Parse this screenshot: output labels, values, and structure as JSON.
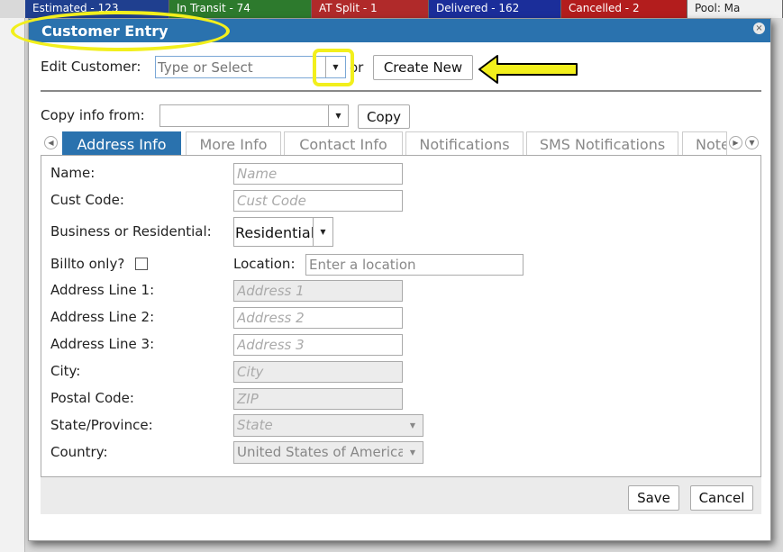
{
  "background": {
    "strip": [
      {
        "text": "Estimated - 123",
        "color": "#1f3f8f"
      },
      {
        "text": "In Transit - 74",
        "color": "#2d7a2d"
      },
      {
        "text": "AT Split - 1",
        "color": "#b02a2a"
      },
      {
        "text": "Delivered - 162",
        "color": "#1b2e9a"
      },
      {
        "text": "Cancelled - 2",
        "color": "#b31d1d"
      },
      {
        "text": "Pool: Ma",
        "color": "#f0f0f0"
      }
    ]
  },
  "dialog": {
    "title": "Customer Entry",
    "close_icon": "×",
    "edit_customer_label": "Edit Customer:",
    "edit_customer_placeholder": "Type or Select",
    "or_label": "or",
    "create_new_label": "Create New",
    "copy_info_label": "Copy info from:",
    "copy_info_value": "",
    "copy_label": "Copy",
    "tabs": [
      "Address Info",
      "More Info",
      "Contact Info",
      "Notifications",
      "SMS Notifications",
      "Notes"
    ],
    "active_tab": "Address Info",
    "form": {
      "name_label": "Name:",
      "name_placeholder": "Name",
      "cust_code_label": "Cust Code:",
      "cust_code_placeholder": "Cust Code",
      "business_label": "Business or Residential:",
      "business_value": "Residential",
      "billto_label": "Billto only?",
      "location_label": "Location:",
      "location_placeholder": "Enter a location",
      "address1_label": "Address Line 1:",
      "address1_placeholder": "Address 1",
      "address2_label": "Address Line 2:",
      "address2_placeholder": "Address 2",
      "address3_label": "Address Line 3:",
      "address3_placeholder": "Address 3",
      "city_label": "City:",
      "city_placeholder": "City",
      "postal_label": "Postal Code:",
      "postal_placeholder": "ZIP",
      "state_label": "State/Province:",
      "state_value": "State",
      "country_label": "Country:",
      "country_value": "United States of America"
    },
    "save_label": "Save",
    "cancel_label": "Cancel"
  },
  "annotation_color": "#f2ef1c"
}
